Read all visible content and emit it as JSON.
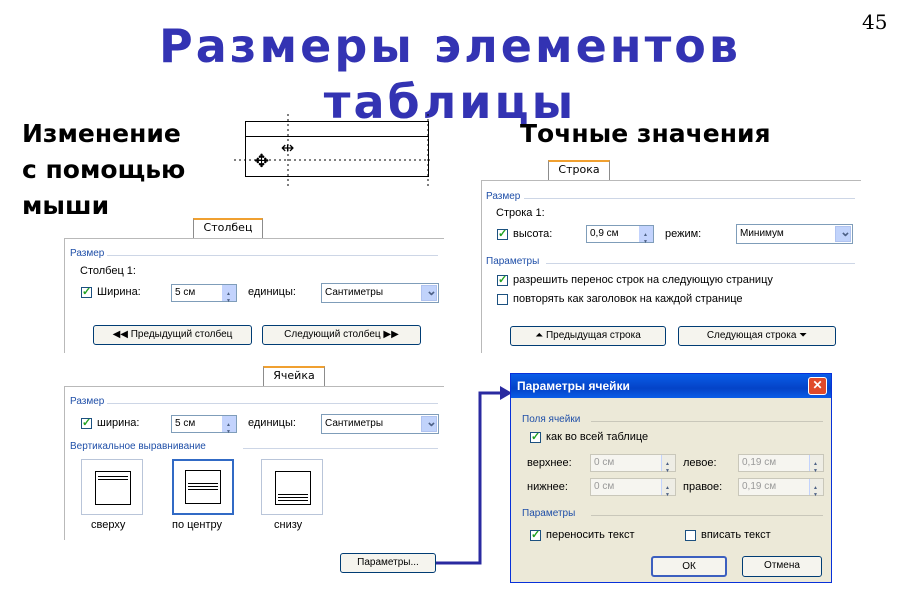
{
  "slide": {
    "title": "Размеры элементов таблицы",
    "page_number": "45",
    "left_label": "Изменение\nс помощью\nмыши",
    "right_label": "Точные значения"
  },
  "column_dialog": {
    "tab": "Столбец",
    "section_size": "Размер",
    "item_label": "Столбец 1:",
    "width_label": "Ширина:",
    "width_value": "5 см",
    "units_label": "единицы:",
    "units_value": "Сантиметры",
    "prev_button": "Предыдущий столбец",
    "next_button": "Следующий столбец"
  },
  "row_dialog": {
    "tab": "Строка",
    "section_size": "Размер",
    "item_label": "Строка 1:",
    "height_label": "высота:",
    "height_value": "0,9 см",
    "mode_label": "режим:",
    "mode_value": "Минимум",
    "section_params": "Параметры",
    "allow_break": "разрешить перенос строк на следующую страницу",
    "repeat_header": "повторять как заголовок на каждой странице",
    "prev_button": "Предыдущая строка",
    "next_button": "Следующая строка"
  },
  "cell_dialog": {
    "tab": "Ячейка",
    "section_size": "Размер",
    "width_label": "ширина:",
    "width_value": "5 см",
    "units_label": "единицы:",
    "units_value": "Сантиметры",
    "section_valign": "Вертикальное выравнивание",
    "align_top": "сверху",
    "align_center": "по центру",
    "align_bottom": "снизу",
    "params_button": "Параметры..."
  },
  "cell_params_dialog": {
    "title": "Параметры ячейки",
    "close": "✕",
    "section_margins": "Поля ячейки",
    "same_as_table": "как во всей таблице",
    "top_label": "верхнее:",
    "top_value": "0 см",
    "left_label": "левое:",
    "left_value": "0,19 см",
    "bottom_label": "нижнее:",
    "bottom_value": "0 см",
    "right_label": "правое:",
    "right_value": "0,19 см",
    "section_params": "Параметры",
    "wrap_text": "переносить текст",
    "fit_text": "вписать текст",
    "ok": "ОК",
    "cancel": "Отмена"
  },
  "colors": {
    "title": "#3333b3",
    "section": "#1f4fa8",
    "arrow": "#2a2aa0",
    "titlebar": "#0a5de8"
  }
}
